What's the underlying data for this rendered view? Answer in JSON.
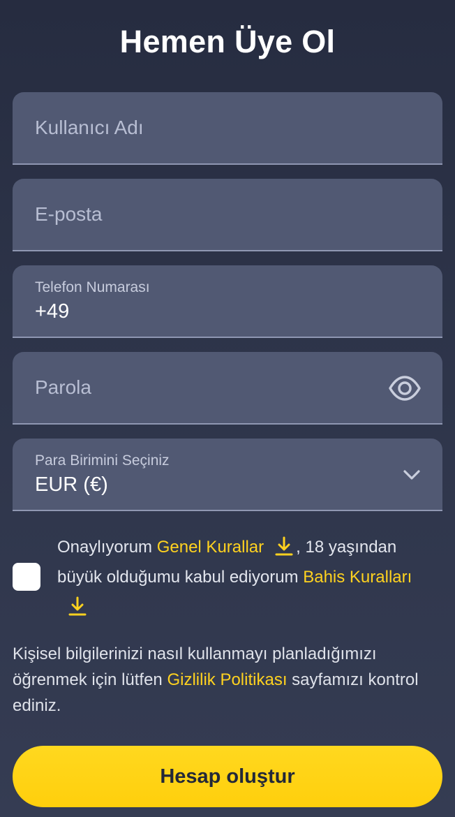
{
  "title": "Hemen Üye Ol",
  "fields": {
    "username": {
      "placeholder": "Kullanıcı Adı"
    },
    "email": {
      "placeholder": "E-posta"
    },
    "phone": {
      "label": "Telefon Numarası",
      "value": "+49"
    },
    "password": {
      "placeholder": "Parola",
      "icon": "eye-icon"
    },
    "currency": {
      "label": "Para Birimini Seçiniz",
      "value": "EUR (€)",
      "icon": "chevron-down-icon"
    }
  },
  "consent": {
    "prefix": "Onaylıyorum",
    "general_rules_link": "Genel Kurallar",
    "middle": ", 18 yaşından büyük olduğumu kabul ediyorum",
    "betting_rules_link": "Bahis Kuralları",
    "download_icon": "download-icon",
    "checked": false
  },
  "privacy": {
    "prefix": "Kişisel bilgilerinizi nasıl kullanmayı planladığımızı öğrenmek için lütfen",
    "link": "Gizlilik Politikası",
    "suffix": "sayfamızı kontrol ediniz."
  },
  "submit_label": "Hesap oluştur",
  "colors": {
    "background": "#2d3449",
    "field": "#515973",
    "accent": "#ffd21f",
    "button_text": "#232838"
  }
}
